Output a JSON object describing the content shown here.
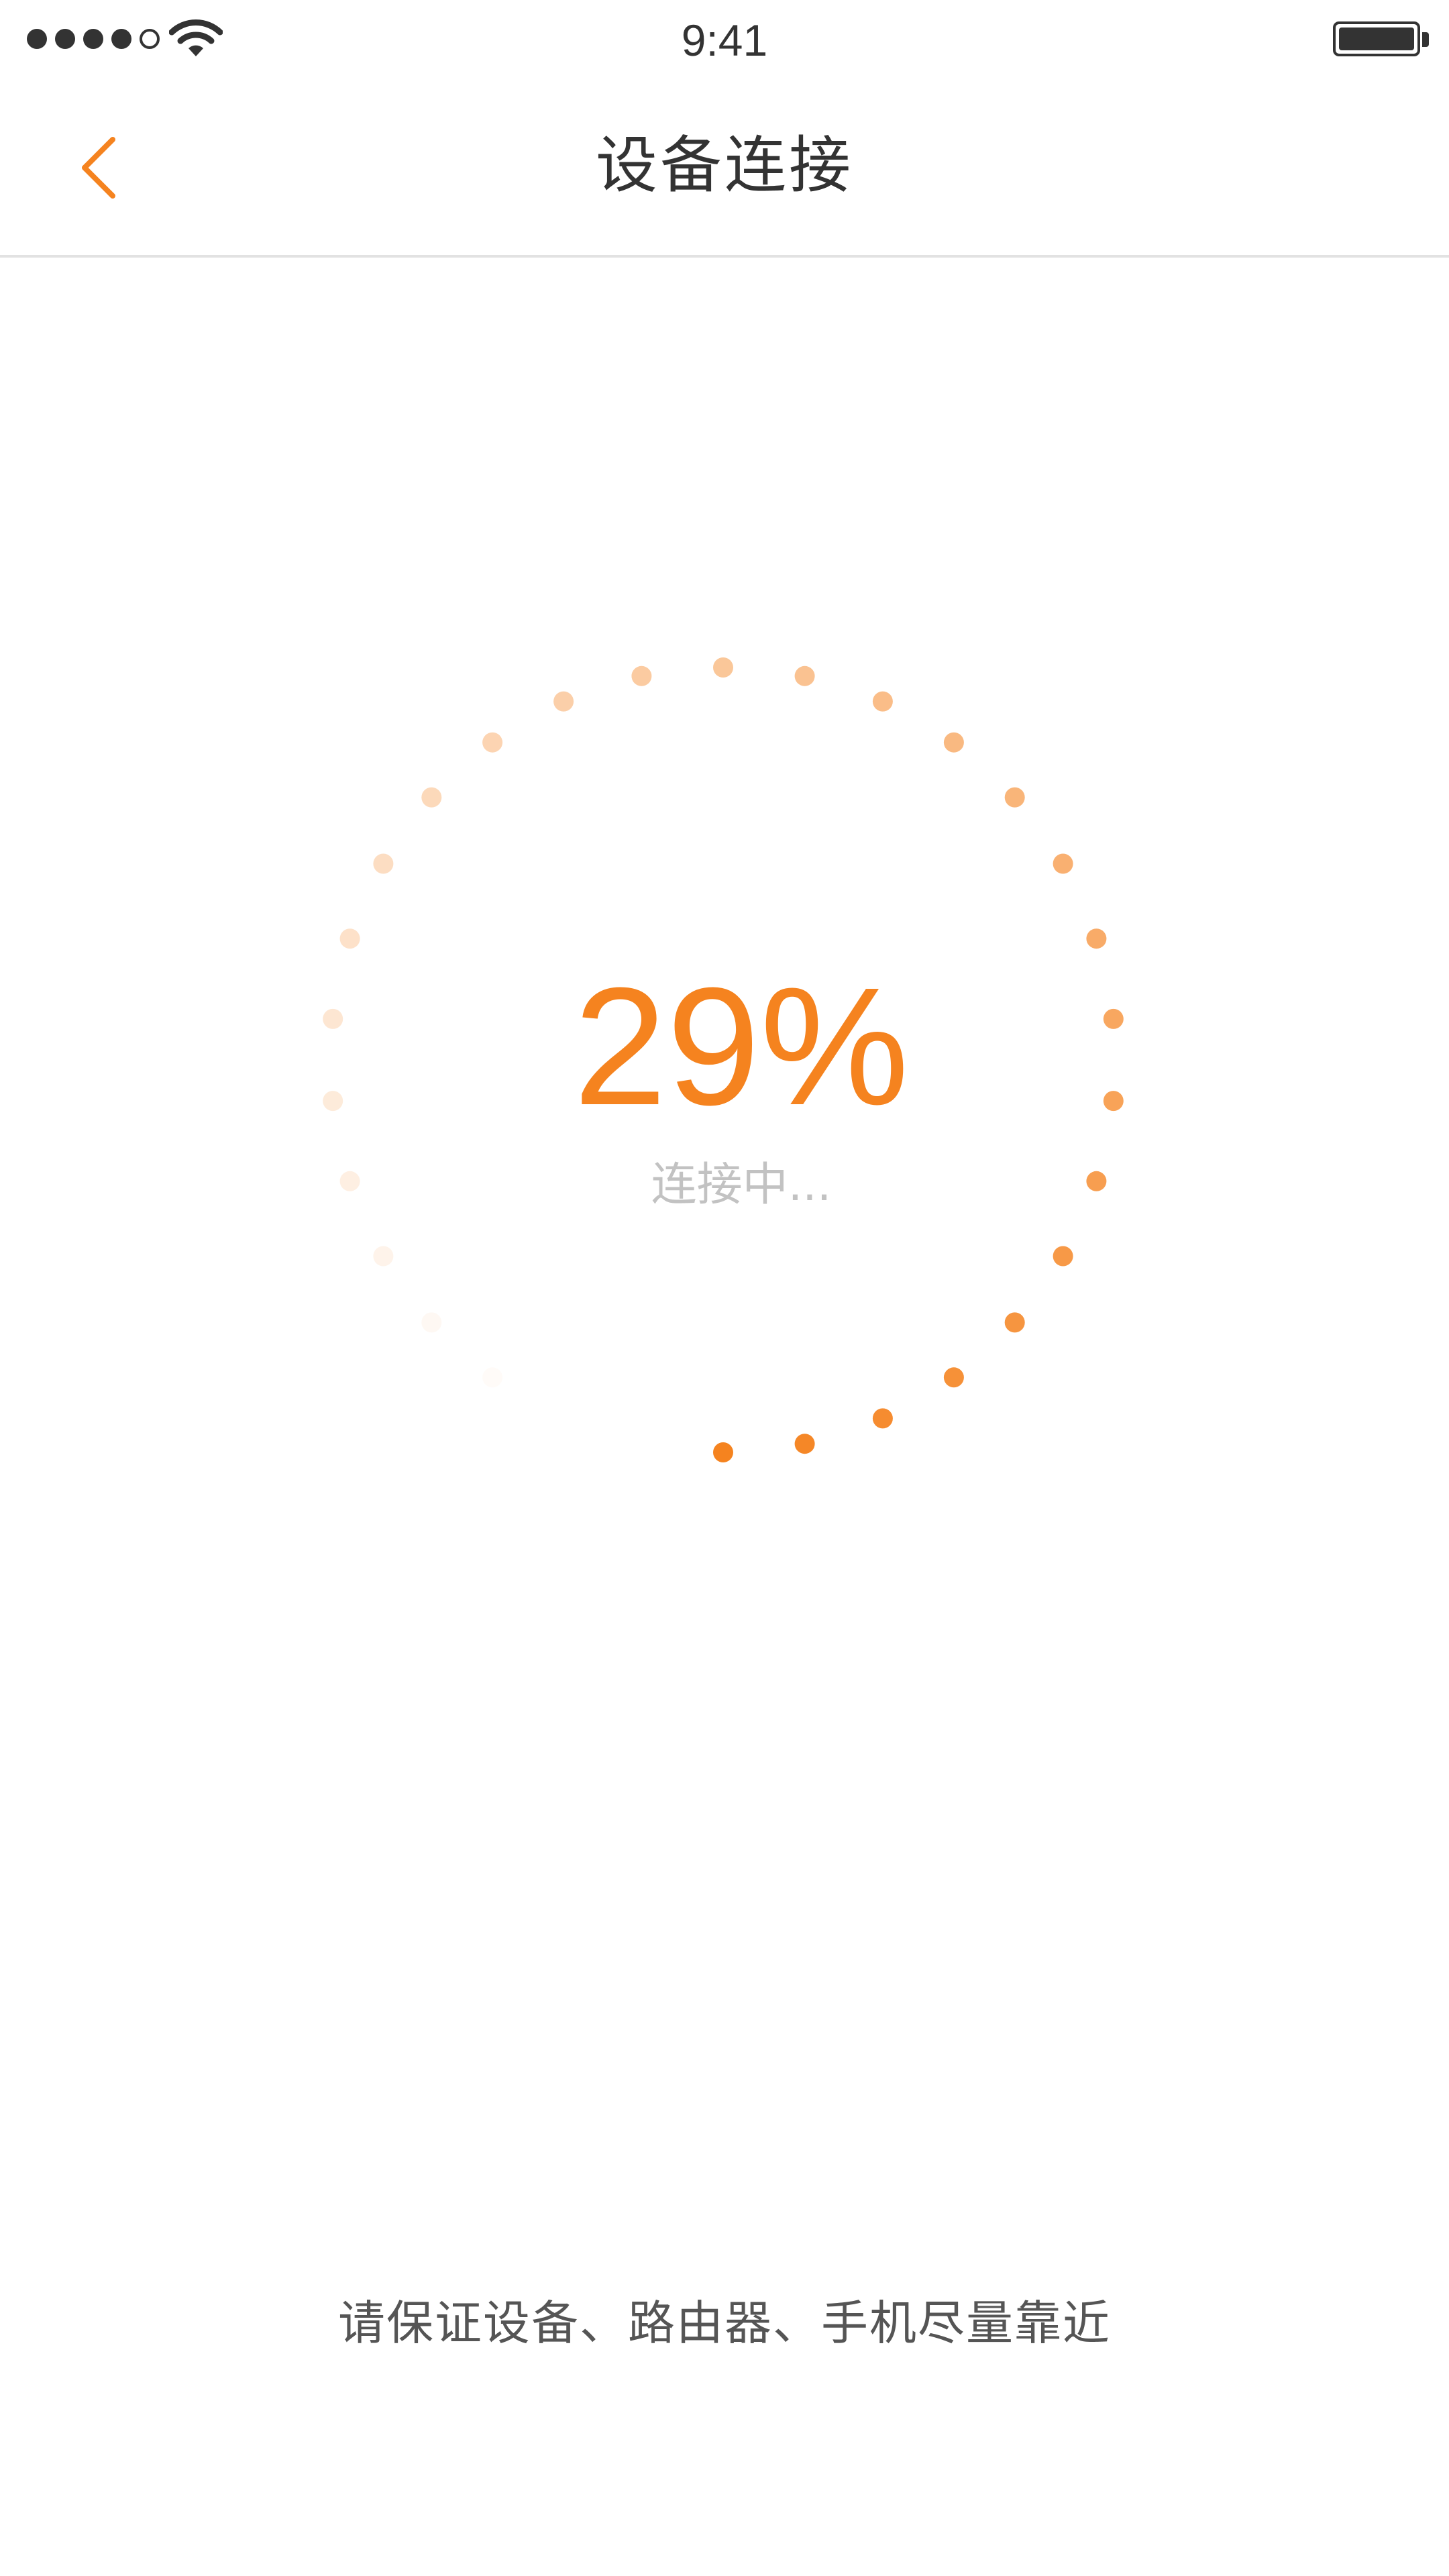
{
  "status_bar": {
    "time": "9:41",
    "signal_bars_filled": 4,
    "signal_bars_total": 5,
    "wifi_icon": "wifi-icon",
    "battery_icon": "battery-full-icon",
    "battery_level": 1.0
  },
  "nav": {
    "back_icon": "chevron-left-icon",
    "title": "设备连接"
  },
  "progress": {
    "percent_text": "29%",
    "value": 0.29,
    "status": "连接中..."
  },
  "hint": "请保证设备、路由器、手机尽量靠近",
  "colors": {
    "accent": "#f5831f",
    "title": "#333333",
    "status_text": "#c2c2c2",
    "hint_text": "#555555",
    "divider": "#e2e2e2"
  }
}
